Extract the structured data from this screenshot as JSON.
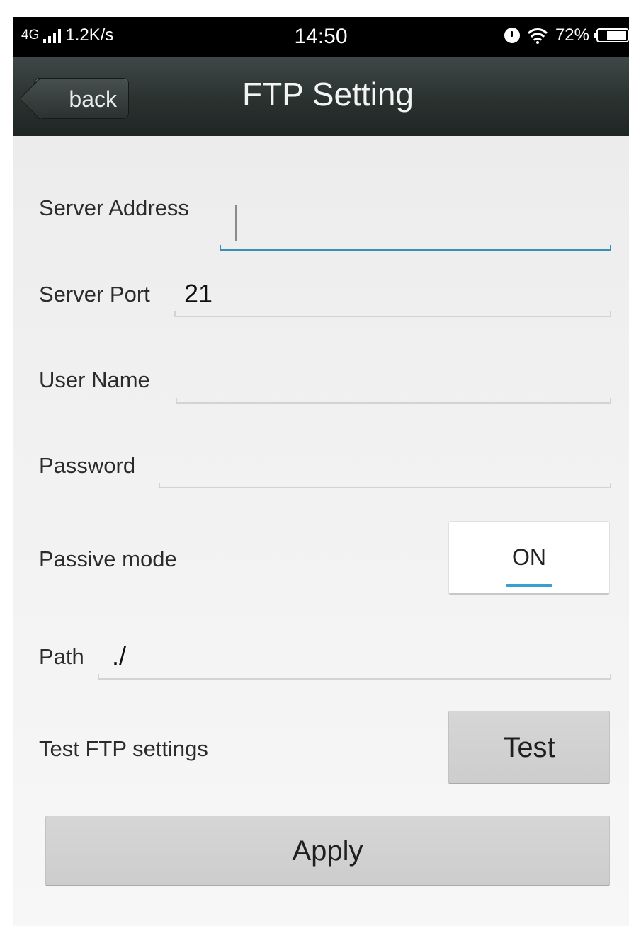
{
  "status_bar": {
    "network": "4G",
    "speed": "1.2K/s",
    "time": "14:50",
    "battery": "72%",
    "battery_level": 0.72,
    "icons": [
      "signal-icon",
      "alarm-icon",
      "wifi-icon",
      "battery-icon"
    ]
  },
  "header": {
    "back_label": "back",
    "title": "FTP Setting"
  },
  "form": {
    "server_address": {
      "label": "Server Address",
      "value": ""
    },
    "server_port": {
      "label": "Server Port",
      "value": "21"
    },
    "user_name": {
      "label": "User Name",
      "value": ""
    },
    "password": {
      "label": "Password",
      "value": ""
    },
    "passive_mode": {
      "label": "Passive mode",
      "value": "ON"
    },
    "path": {
      "label": "Path",
      "value": "./"
    },
    "test": {
      "label": "Test FTP settings",
      "button": "Test"
    },
    "apply_button": "Apply"
  },
  "colors": {
    "accent": "#3a9fd0",
    "titlebar": "#2a3230",
    "button": "#d2d2d2"
  }
}
